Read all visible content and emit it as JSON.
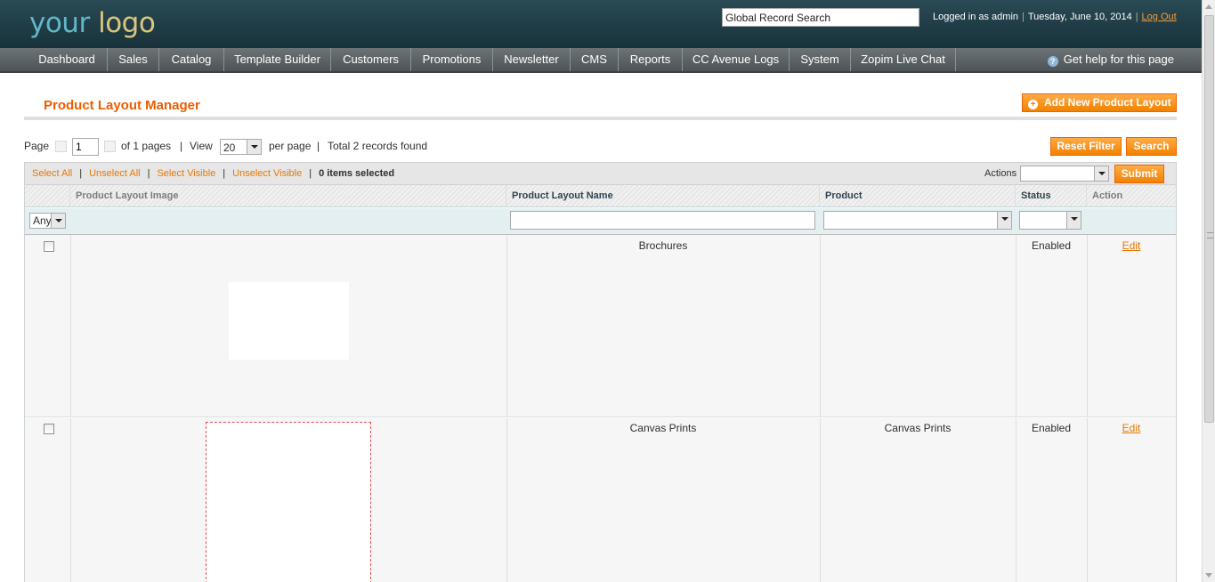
{
  "header": {
    "logo_part1": "your",
    "logo_part2": "logo",
    "search_value": "Global Record Search",
    "logged_in": "Logged in as admin",
    "date": "Tuesday, June 10, 2014",
    "logout": "Log Out"
  },
  "nav": {
    "items": [
      "Dashboard",
      "Sales",
      "Catalog",
      "Template Builder",
      "Customers",
      "Promotions",
      "Newsletter",
      "CMS",
      "Reports",
      "CC Avenue Logs",
      "System",
      "Zopim Live Chat"
    ],
    "help": "Get help for this page"
  },
  "page": {
    "title": "Product Layout Manager",
    "add_button": "Add New Product Layout",
    "reset_filter": "Reset Filter",
    "search": "Search"
  },
  "pager": {
    "page_label": "Page",
    "page_value": "1",
    "of_pages": "of 1 pages",
    "view_label": "View",
    "per_page_value": "20",
    "per_page_label": "per page",
    "total": "Total 2 records found"
  },
  "massaction": {
    "select_all": "Select All",
    "unselect_all": "Unselect All",
    "select_visible": "Select Visible",
    "unselect_visible": "Unselect Visible",
    "selected": "0 items selected",
    "actions_label": "Actions",
    "actions_value": "",
    "submit": "Submit"
  },
  "grid": {
    "columns": [
      "Product Layout Image",
      "Product Layout Name",
      "Product",
      "Status",
      "Action"
    ],
    "filter_any": "Any",
    "rows": [
      {
        "name": "Brochures",
        "product": "",
        "status": "Enabled",
        "action": "Edit"
      },
      {
        "name": "Canvas Prints",
        "product": "Canvas Prints",
        "status": "Enabled",
        "action": "Edit"
      }
    ]
  },
  "icons": {
    "help": "help-icon",
    "add": "plus-circle-icon"
  },
  "colors": {
    "accent": "#eb5e00",
    "button": "#f18200",
    "header": "#1f3c45",
    "nav": "#5a6164"
  }
}
